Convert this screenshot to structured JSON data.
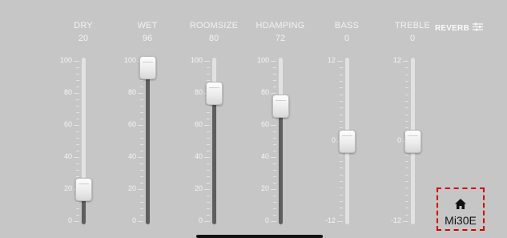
{
  "channels": [
    {
      "name": "DRY",
      "value": "20",
      "level": 20,
      "scale": [
        "100",
        "80",
        "60",
        "40",
        "20",
        "0"
      ]
    },
    {
      "name": "WET",
      "value": "96",
      "level": 96,
      "scale": [
        "100",
        "80",
        "60",
        "40",
        "20",
        "0"
      ]
    },
    {
      "name": "ROOMSIZE",
      "value": "80",
      "level": 80,
      "scale": [
        "100",
        "80",
        "60",
        "40",
        "20",
        "0"
      ]
    },
    {
      "name": "HDAMPING",
      "value": "72",
      "level": 72,
      "scale": [
        "100",
        "80",
        "60",
        "40",
        "20",
        "0"
      ]
    },
    {
      "name": "BASS",
      "value": "0",
      "level": 50,
      "scale": [
        "12",
        "0",
        "-12"
      ]
    },
    {
      "name": "TREBLE",
      "value": "0",
      "level": 50,
      "scale": [
        "12",
        "0",
        "-12"
      ]
    }
  ],
  "reverb": {
    "label": "REVERB",
    "icon": "sliders-icon"
  },
  "home": {
    "label": "Mi30E",
    "icon": "home-icon"
  },
  "colors": {
    "background": "#c6c6c6",
    "track": "#e2e2e2",
    "fill": "#5e5e5e",
    "highlight": "#d40000"
  }
}
